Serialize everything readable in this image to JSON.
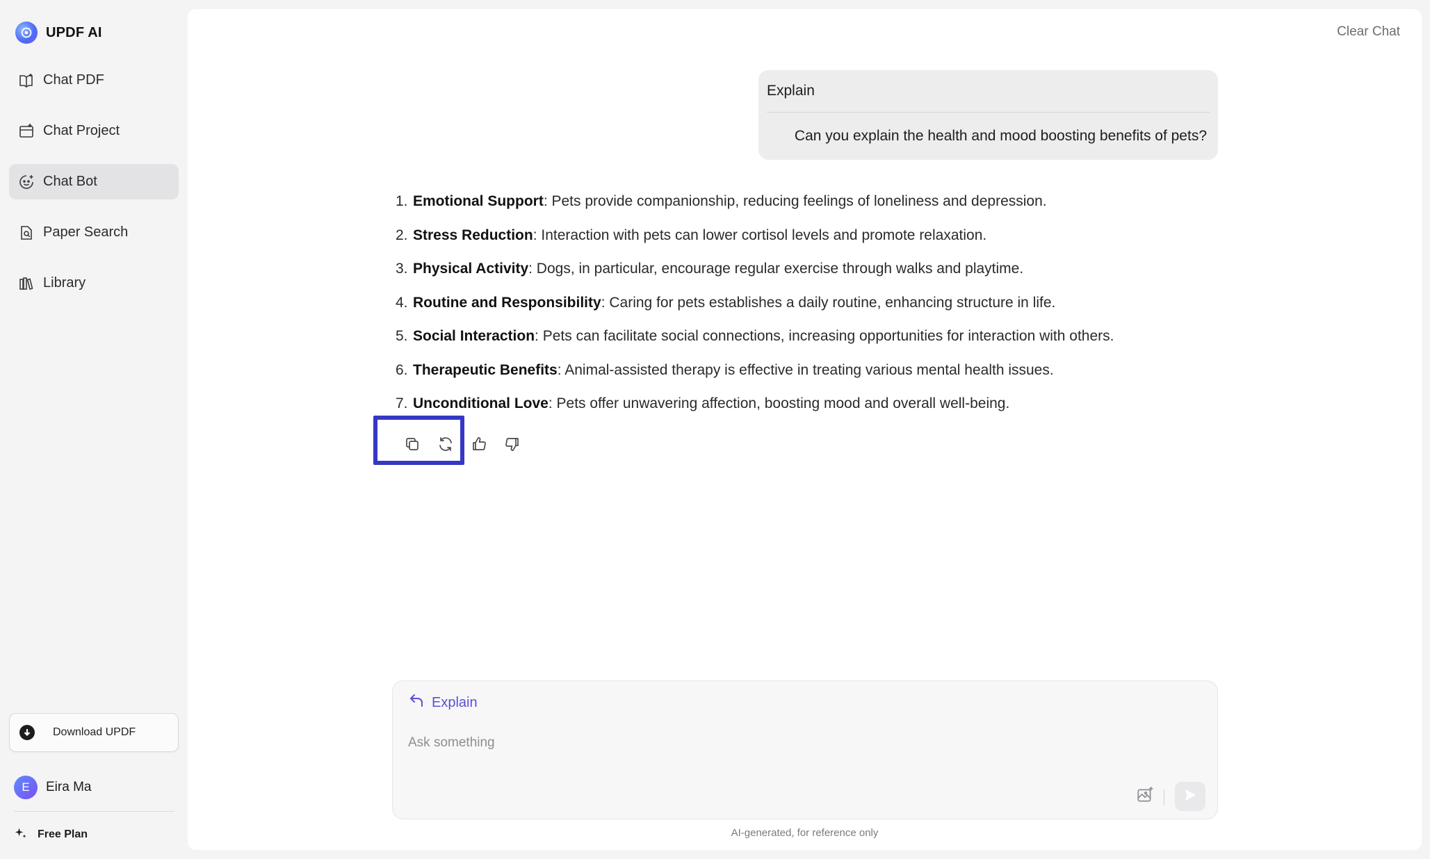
{
  "brand": {
    "name": "UPDF AI"
  },
  "sidebar": {
    "items": [
      {
        "label": "Chat PDF",
        "icon": "book-open-icon",
        "active": false
      },
      {
        "label": "Chat Project",
        "icon": "folder-plus-icon",
        "active": false
      },
      {
        "label": "Chat Bot",
        "icon": "bot-face-icon",
        "active": true
      },
      {
        "label": "Paper Search",
        "icon": "doc-search-icon",
        "active": false
      },
      {
        "label": "Library",
        "icon": "library-icon",
        "active": false
      }
    ],
    "download_label": "Download UPDF",
    "user": {
      "initial": "E",
      "name": "Eira Ma"
    },
    "plan_label": "Free Plan"
  },
  "header": {
    "clear_chat": "Clear Chat"
  },
  "conversation": {
    "user_message": {
      "label": "Explain",
      "text": "Can you explain the health and mood boosting benefits of pets?"
    },
    "answer": [
      {
        "num": "1.",
        "title": "Emotional Support",
        "text": " : Pets provide companionship, reducing feelings of loneliness and depression."
      },
      {
        "num": "2.",
        "title": "Stress Reduction",
        "text": " : Interaction with pets can lower cortisol levels and promote relaxation."
      },
      {
        "num": "3.",
        "title": "Physical Activity",
        "text": " : Dogs, in particular, encourage regular exercise through walks and playtime."
      },
      {
        "num": "4.",
        "title": "Routine and Responsibility",
        "text": " : Caring for pets establishes a daily routine, enhancing structure in life."
      },
      {
        "num": "5.",
        "title": "Social Interaction",
        "text": " : Pets can facilitate social connections, increasing opportunities for interaction with others."
      },
      {
        "num": "6.",
        "title": "Therapeutic Benefits",
        "text": " : Animal-assisted therapy is effective in treating various mental health issues."
      },
      {
        "num": "7.",
        "title": "Unconditional Love",
        "text": " : Pets offer unwavering affection, boosting mood and overall well-being."
      }
    ],
    "actions": [
      "copy-icon",
      "regenerate-icon",
      "thumbs-up-icon",
      "thumbs-down-icon"
    ]
  },
  "composer": {
    "quote_label": "Explain",
    "placeholder": "Ask something",
    "value": ""
  },
  "footer": {
    "disclaimer": "AI-generated, for reference only"
  },
  "colors": {
    "accent": "#5a4fd6",
    "highlight": "#3637c4",
    "active_nav_bg": "#e3e3e6"
  }
}
